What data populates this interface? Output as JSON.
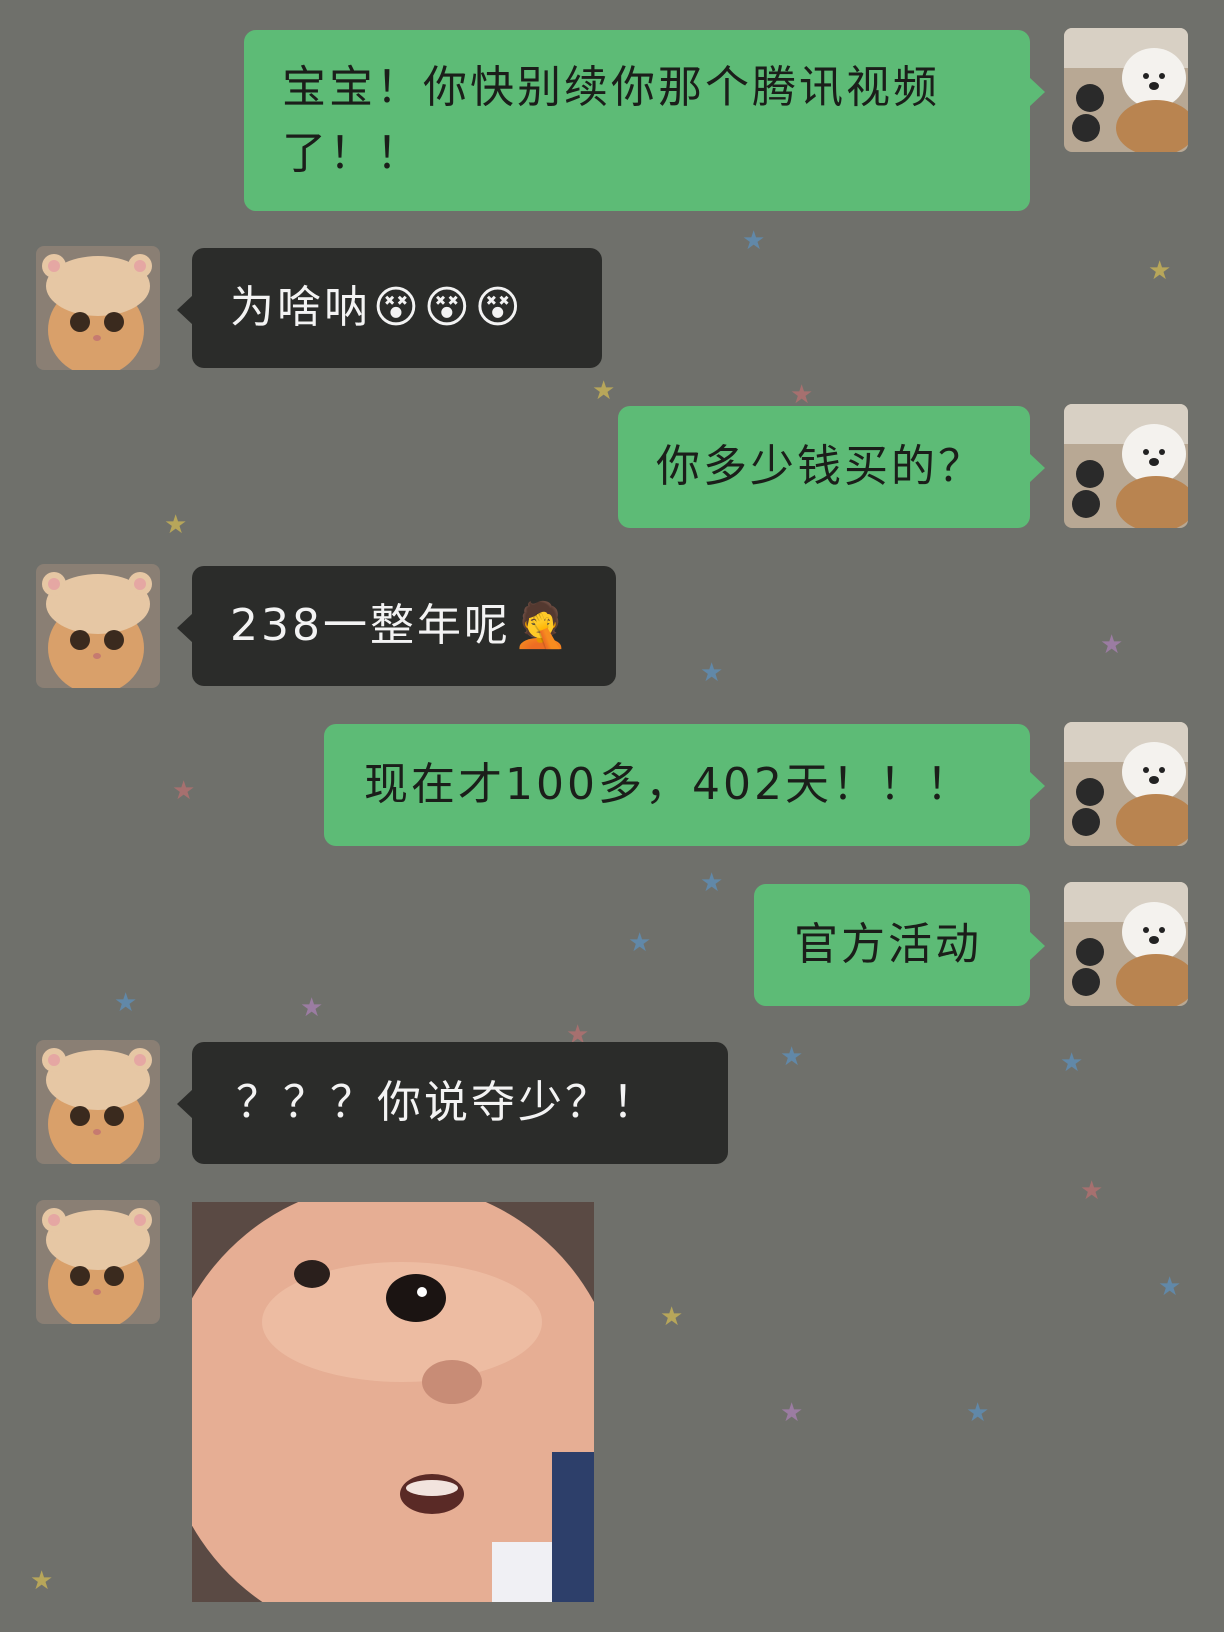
{
  "chat": {
    "messages": [
      {
        "side": "right",
        "text": "宝宝！你快别续你那个腾讯视频了！！"
      },
      {
        "side": "left",
        "text": "为啥呐",
        "emojis": [
          "confused-face-emoji",
          "confused-face-emoji",
          "confused-face-emoji"
        ]
      },
      {
        "side": "right",
        "text": "你多少钱买的？"
      },
      {
        "side": "left",
        "text": "238一整年呢",
        "emojis": [
          "face-palm-laughing-emoji"
        ]
      },
      {
        "side": "right",
        "text": "现在才100多，402天！！！"
      },
      {
        "side": "right",
        "text": "官方活动"
      },
      {
        "side": "left",
        "text": "？？？你说夺少？！"
      },
      {
        "side": "left",
        "image": "surprised-baby-sticker"
      }
    ]
  },
  "avatars": {
    "self": "white-dog-avatar",
    "other": "cat-in-bear-hat-avatar"
  },
  "colors": {
    "background": "#6f706b",
    "self_bubble": "#5dbb76",
    "other_bubble": "#2b2c2a"
  }
}
